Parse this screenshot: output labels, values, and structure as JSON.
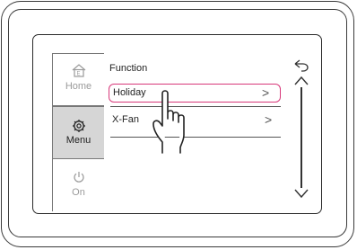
{
  "device": {
    "sidebar": {
      "items": [
        {
          "label": "Home",
          "icon": "home-icon"
        },
        {
          "label": "Menu",
          "icon": "gear-icon",
          "selected": true
        },
        {
          "label": "On",
          "icon": "power-icon"
        }
      ]
    },
    "main": {
      "title": "Function",
      "rows": [
        {
          "label": "Holiday",
          "chevron": ">",
          "highlighted": true
        },
        {
          "label": "X-Fan",
          "chevron": ">"
        }
      ]
    },
    "scroll": {
      "back_icon": "back-arrow-icon",
      "up_icon": "chevron-up-icon",
      "down_icon": "chevron-down-icon"
    },
    "overlay": {
      "icon": "hand-pointer-icon"
    },
    "colors": {
      "highlight": "#d8397a",
      "menu_selected_bg": "#d6d6d6"
    }
  }
}
